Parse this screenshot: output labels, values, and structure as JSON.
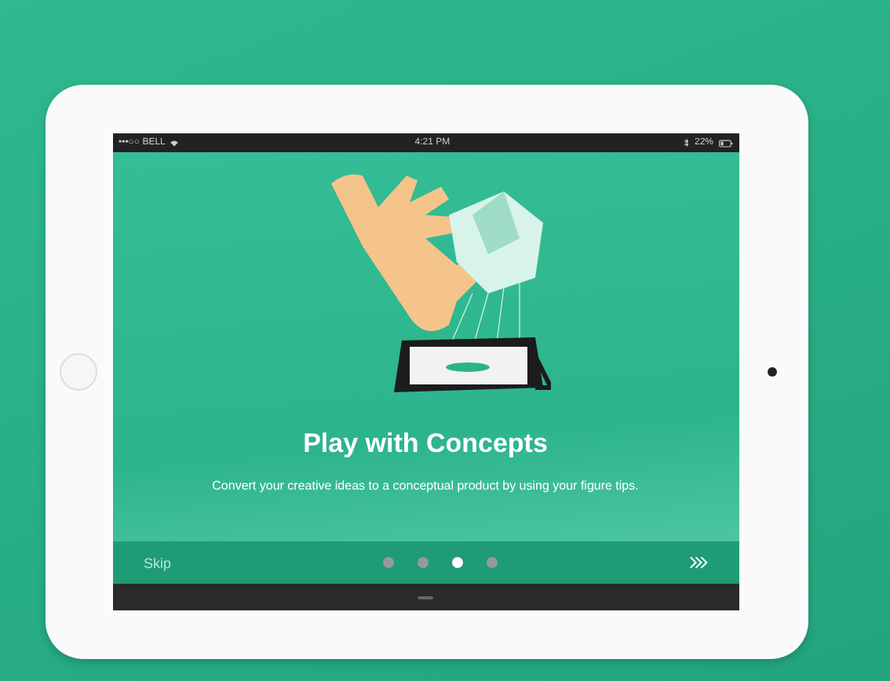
{
  "status_bar": {
    "carrier": "•••○○ BELL",
    "time": "4:21 PM",
    "battery": "22%"
  },
  "onboarding": {
    "title": "Play with Concepts",
    "description": "Convert your creative ideas to a conceptual product by using your figure tips."
  },
  "footer": {
    "skip": "Skip",
    "pages": [
      {
        "selected": false
      },
      {
        "selected": false
      },
      {
        "selected": true
      },
      {
        "selected": false
      }
    ]
  }
}
